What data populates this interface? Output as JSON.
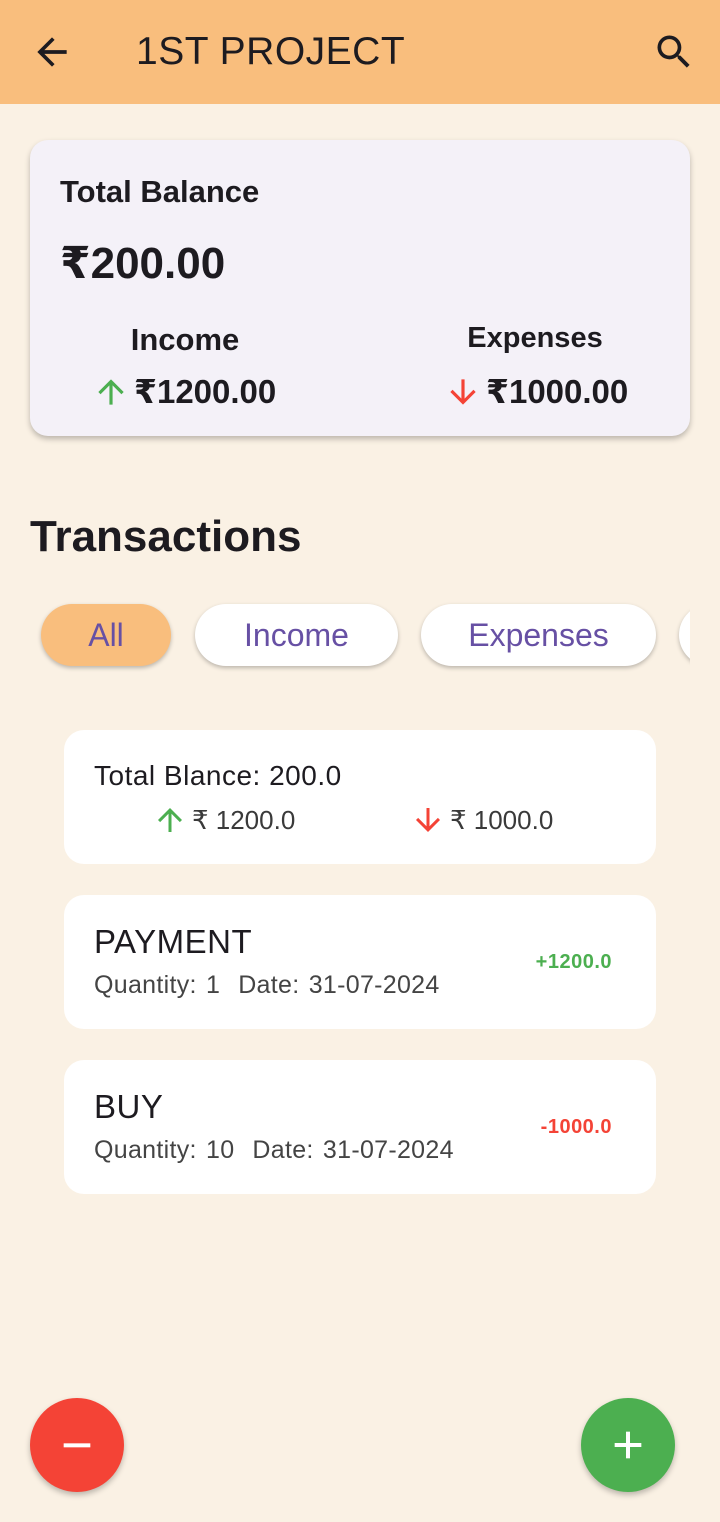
{
  "app_bar": {
    "title": "1ST PROJECT",
    "back_icon": "arrow-back-icon",
    "search_icon": "search-icon"
  },
  "balance_card": {
    "label": "Total Balance",
    "amount": "₹200.00",
    "income_label": "Income",
    "income_value": "₹1200.00",
    "expenses_label": "Expenses",
    "expenses_value": "₹1000.00"
  },
  "transactions": {
    "title": "Transactions",
    "filters": [
      "All",
      "Income",
      "Expenses"
    ],
    "active_filter": "All",
    "summary": {
      "text": "Total Blance: 200.0",
      "income": "₹ 1200.0",
      "expense": "₹ 1000.0"
    },
    "items": [
      {
        "name": "PAYMENT",
        "quantity": "Quantity: 1",
        "date": "Date: 31-07-2024",
        "amount": "+1200.0",
        "type": "income"
      },
      {
        "name": "BUY",
        "quantity": "Quantity: 10",
        "date": "Date: 31-07-2024",
        "amount": "-1000.0",
        "type": "expense"
      }
    ]
  },
  "fabs": {
    "remove_icon": "minus-icon",
    "add_icon": "plus-icon"
  },
  "colors": {
    "app_bar": "#F9BE7D",
    "background": "#FAF1E4",
    "income": "#4CAF50",
    "expense": "#F44336",
    "chip_text": "#6750A4"
  }
}
